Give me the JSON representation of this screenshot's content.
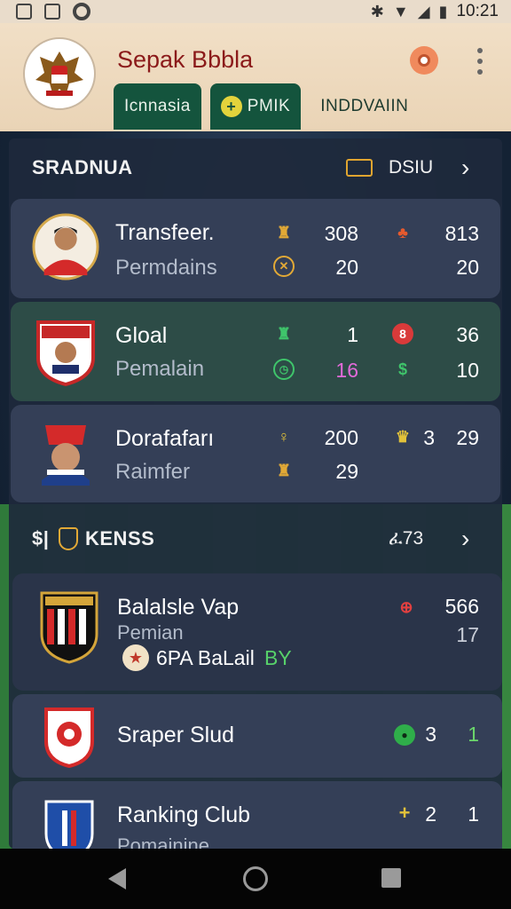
{
  "status_bar": {
    "time": "10:21"
  },
  "app": {
    "title": "Sepak Bbbla",
    "tabs": [
      {
        "label": "Icnnasia",
        "active": true
      },
      {
        "label": "PMIK",
        "active": true,
        "icon": "ball-icon"
      },
      {
        "label": "INDDVAIIN",
        "active": false
      }
    ]
  },
  "section1": {
    "title": "SRADNUA",
    "aux_label": "DSIU",
    "cards": [
      {
        "name": "Transfeer.",
        "sub": "Permdains",
        "stats": [
          "308",
          "813",
          "20",
          "20"
        ]
      },
      {
        "name": "Gloal",
        "sub": "Pemalain",
        "stats": [
          "1",
          "36",
          "16",
          "10"
        ]
      },
      {
        "name": "Dorafafarı",
        "sub": "Raimfer",
        "stats": [
          "200",
          "3",
          "29",
          "29"
        ]
      }
    ]
  },
  "section2": {
    "title": "KENSS",
    "prefix": "$|",
    "aux_label": "ፈ73",
    "cards": [
      {
        "name": "Balalsle Vap",
        "sub": "Pemian",
        "extra": "6PA BaLail",
        "extra_tag": "BY",
        "stats": [
          "566",
          "17"
        ]
      },
      {
        "name": "Sraper Slud",
        "stats": [
          "3",
          "1"
        ]
      },
      {
        "name": "Ranking Club",
        "sub": "Pomainine",
        "stats": [
          "2",
          "1"
        ]
      }
    ]
  },
  "colors": {
    "header_bg": "#ead4b6",
    "title_red": "#8b1a1a",
    "tab_green": "#14543d",
    "card_bg": "#364058",
    "card_green": "#2e4e48"
  }
}
